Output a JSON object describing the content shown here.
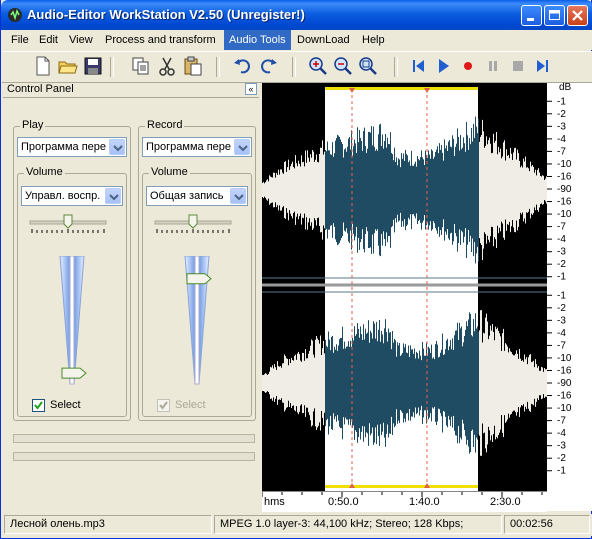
{
  "window": {
    "title": "Audio-Editor WorkStation V2.50 (Unregister!)"
  },
  "menu": [
    "File",
    "Edit",
    "View",
    "Process and transform",
    "Audio Tools",
    "DownLoad",
    "Help"
  ],
  "menu_active": "Audio Tools",
  "control_panel": {
    "title": "Control Panel",
    "collapse_glyph": "«",
    "play": {
      "label": "Play",
      "device": "Программа пере",
      "volume_label": "Volume",
      "volume_source": "Управл. воспр.",
      "volume_level": 0.05,
      "balance": 0.5,
      "select_label": "Select",
      "select_checked": true
    },
    "record": {
      "label": "Record",
      "device": "Программа пере",
      "volume_label": "Volume",
      "volume_source": "Общая запись",
      "volume_level": 0.85,
      "balance": 0.5,
      "select_label": "Select",
      "select_checked": true,
      "select_disabled": true
    }
  },
  "ruler": {
    "unit": "dB",
    "labels_top": [
      "-1",
      "-2",
      "-3",
      "-4",
      "-7",
      "-10",
      "-16",
      "-90",
      "-16",
      "-10",
      "-7",
      "-4",
      "-3",
      "-2",
      "-1"
    ],
    "labels_bottom": [
      "-1",
      "-2",
      "-3",
      "-4",
      "-7",
      "-10",
      "-16",
      "-90",
      "-16",
      "-10",
      "-7",
      "-4",
      "-3",
      "-2",
      "-1"
    ]
  },
  "timeline": {
    "unit": "hms",
    "ticks": [
      "0:50.0",
      "1:40.0",
      "2:30.0"
    ]
  },
  "status": {
    "file": "Лесной  олень.mp3",
    "format": "MPEG 1.0 layer-3: 44,100 kHz; Stereo; 128 Kbps;",
    "duration": "00:02:56"
  },
  "colors": {
    "waveform_unselected": "#f0ece6",
    "waveform_selected": "#1f4b63",
    "selection_bg": "#ffffff",
    "marker": "#e0604a",
    "selection_edge": "#f0e000"
  },
  "icons": {
    "title": "app-icon",
    "new": "new-file-icon",
    "open": "open-folder-icon",
    "save": "save-icon",
    "copy": "copy-icon",
    "cut": "cut-icon",
    "paste": "paste-icon",
    "undo": "undo-icon",
    "redo": "redo-icon",
    "zoom_in": "zoom-in-icon",
    "zoom_out": "zoom-out-icon",
    "zoom_fit": "zoom-fit-icon",
    "prev": "skip-back-icon",
    "play": "play-icon",
    "record": "record-icon",
    "pause": "pause-icon",
    "stop": "stop-icon",
    "next": "skip-forward-icon"
  }
}
